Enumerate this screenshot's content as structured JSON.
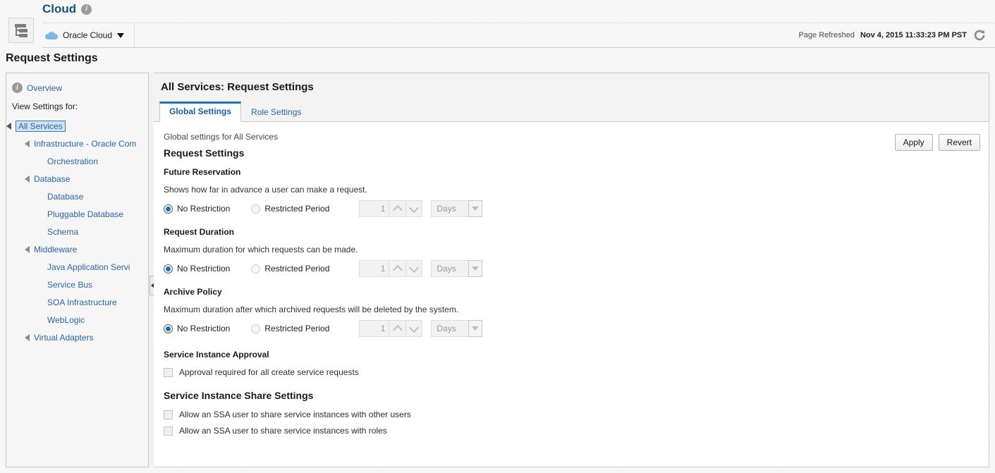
{
  "header": {
    "app_title": "Cloud",
    "info_icon": "info-icon",
    "tree_toggle_icon": "tree-hierarchy-icon",
    "cloud_chooser_label": "Oracle Cloud",
    "cloud_icon": "cloud-icon",
    "dropdown_icon": "chevron-down-icon",
    "refresh_label": "Page Refreshed",
    "refresh_timestamp": "Nov 4, 2015 11:33:23 PM PST",
    "refresh_icon": "refresh-icon"
  },
  "page_title": "Request Settings",
  "sidebar": {
    "overview_label": "Overview",
    "overview_icon": "info-icon",
    "view_settings_label": "View Settings for:",
    "tree": [
      {
        "label": "All Services",
        "level": 0,
        "expandable": true,
        "selected": true
      },
      {
        "label": "Infrastructure - Oracle Com",
        "level": 1,
        "expandable": true,
        "selected": false
      },
      {
        "label": "Orchestration",
        "level": 2,
        "expandable": false,
        "selected": false
      },
      {
        "label": "Database",
        "level": 1,
        "expandable": true,
        "selected": false
      },
      {
        "label": "Database",
        "level": 2,
        "expandable": false,
        "selected": false
      },
      {
        "label": "Pluggable Database",
        "level": 2,
        "expandable": false,
        "selected": false
      },
      {
        "label": "Schema",
        "level": 2,
        "expandable": false,
        "selected": false
      },
      {
        "label": "Middleware",
        "level": 1,
        "expandable": true,
        "selected": false
      },
      {
        "label": "Java Application Servi",
        "level": 2,
        "expandable": false,
        "selected": false
      },
      {
        "label": "Service Bus",
        "level": 2,
        "expandable": false,
        "selected": false
      },
      {
        "label": "SOA Infrastructure",
        "level": 2,
        "expandable": false,
        "selected": false
      },
      {
        "label": "WebLogic",
        "level": 2,
        "expandable": false,
        "selected": false
      },
      {
        "label": "Virtual Adapters",
        "level": 1,
        "expandable": true,
        "selected": false
      }
    ],
    "collapse_handle_icon": "chevron-left-icon"
  },
  "content": {
    "title": "All Services: Request Settings",
    "tabs": [
      {
        "label": "Global Settings",
        "active": true
      },
      {
        "label": "Role Settings",
        "active": false
      }
    ],
    "buttons": {
      "apply_label": "Apply",
      "revert_label": "Revert"
    },
    "intro_note": "Global settings for All Services",
    "section_heading": "Request Settings",
    "groups": [
      {
        "heading": "Future Reservation",
        "description": "Shows how far in advance a user can make a request.",
        "radio_no_restriction": "No Restriction",
        "radio_restricted_period": "Restricted Period",
        "selected": "No Restriction",
        "spinner_value": "1",
        "unit_value": "Days"
      },
      {
        "heading": "Request Duration",
        "description": "Maximum duration for which requests can be made.",
        "radio_no_restriction": "No Restriction",
        "radio_restricted_period": "Restricted Period",
        "selected": "No Restriction",
        "spinner_value": "1",
        "unit_value": "Days"
      },
      {
        "heading": "Archive Policy",
        "description": "Maximum duration after which archived requests will be deleted by the system.",
        "radio_no_restriction": "No Restriction",
        "radio_restricted_period": "Restricted Period",
        "selected": "No Restriction",
        "spinner_value": "1",
        "unit_value": "Days"
      }
    ],
    "approval": {
      "heading": "Service Instance Approval",
      "checkbox_label": "Approval required for all create service requests",
      "checked": false
    },
    "share_settings": {
      "heading": "Service Instance Share Settings",
      "checkboxes": [
        {
          "label": "Allow an SSA user to share service instances with other users",
          "checked": false
        },
        {
          "label": "Allow an SSA user to share service instances with roles",
          "checked": false
        }
      ]
    }
  },
  "colors": {
    "brand_blue": "#14517b",
    "link_blue": "#2a64a8",
    "active_tab": "#1b74bb",
    "selection_bg": "#cfe3f5"
  }
}
